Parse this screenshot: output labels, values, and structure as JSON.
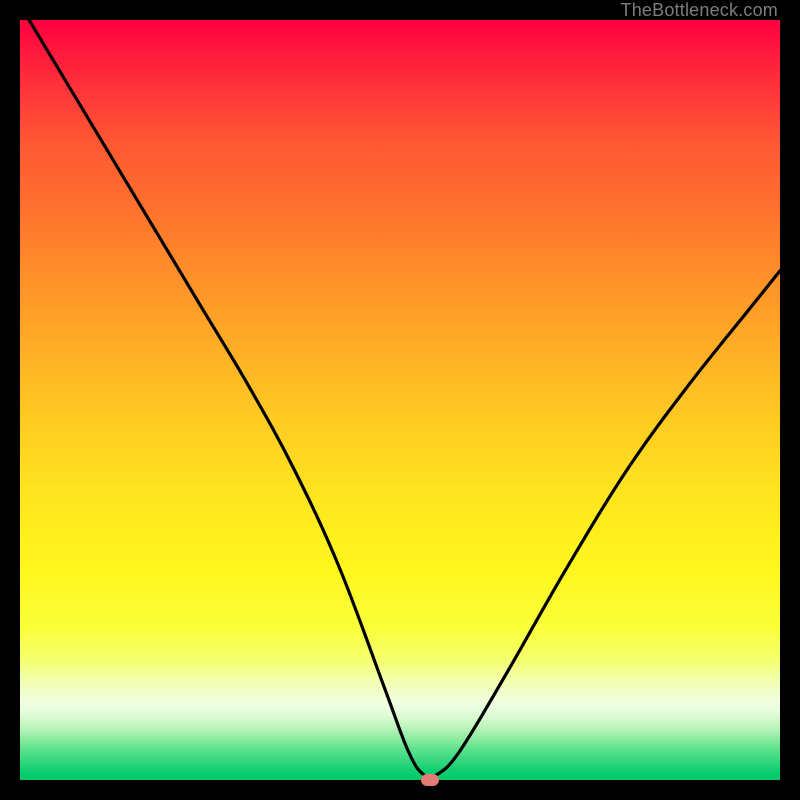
{
  "watermark": "TheBottleneck.com",
  "chart_data": {
    "type": "line",
    "title": "",
    "xlabel": "",
    "ylabel": "",
    "xlim": [
      0,
      100
    ],
    "ylim": [
      0,
      100
    ],
    "grid": false,
    "legend": false,
    "background": "rainbow-vertical",
    "marker": {
      "x": 54,
      "y": 0,
      "color": "#e37b76"
    },
    "series": [
      {
        "name": "bottleneck-curve",
        "color": "#000000",
        "x": [
          0,
          6,
          12,
          18,
          24,
          30,
          36,
          42,
          48,
          51,
          53,
          55,
          58,
          64,
          72,
          80,
          88,
          96,
          100
        ],
        "y": [
          102,
          92,
          82,
          72,
          62,
          52,
          41,
          28,
          12,
          4,
          0.8,
          0.8,
          4,
          14,
          28,
          41,
          52,
          62,
          67
        ]
      }
    ]
  }
}
